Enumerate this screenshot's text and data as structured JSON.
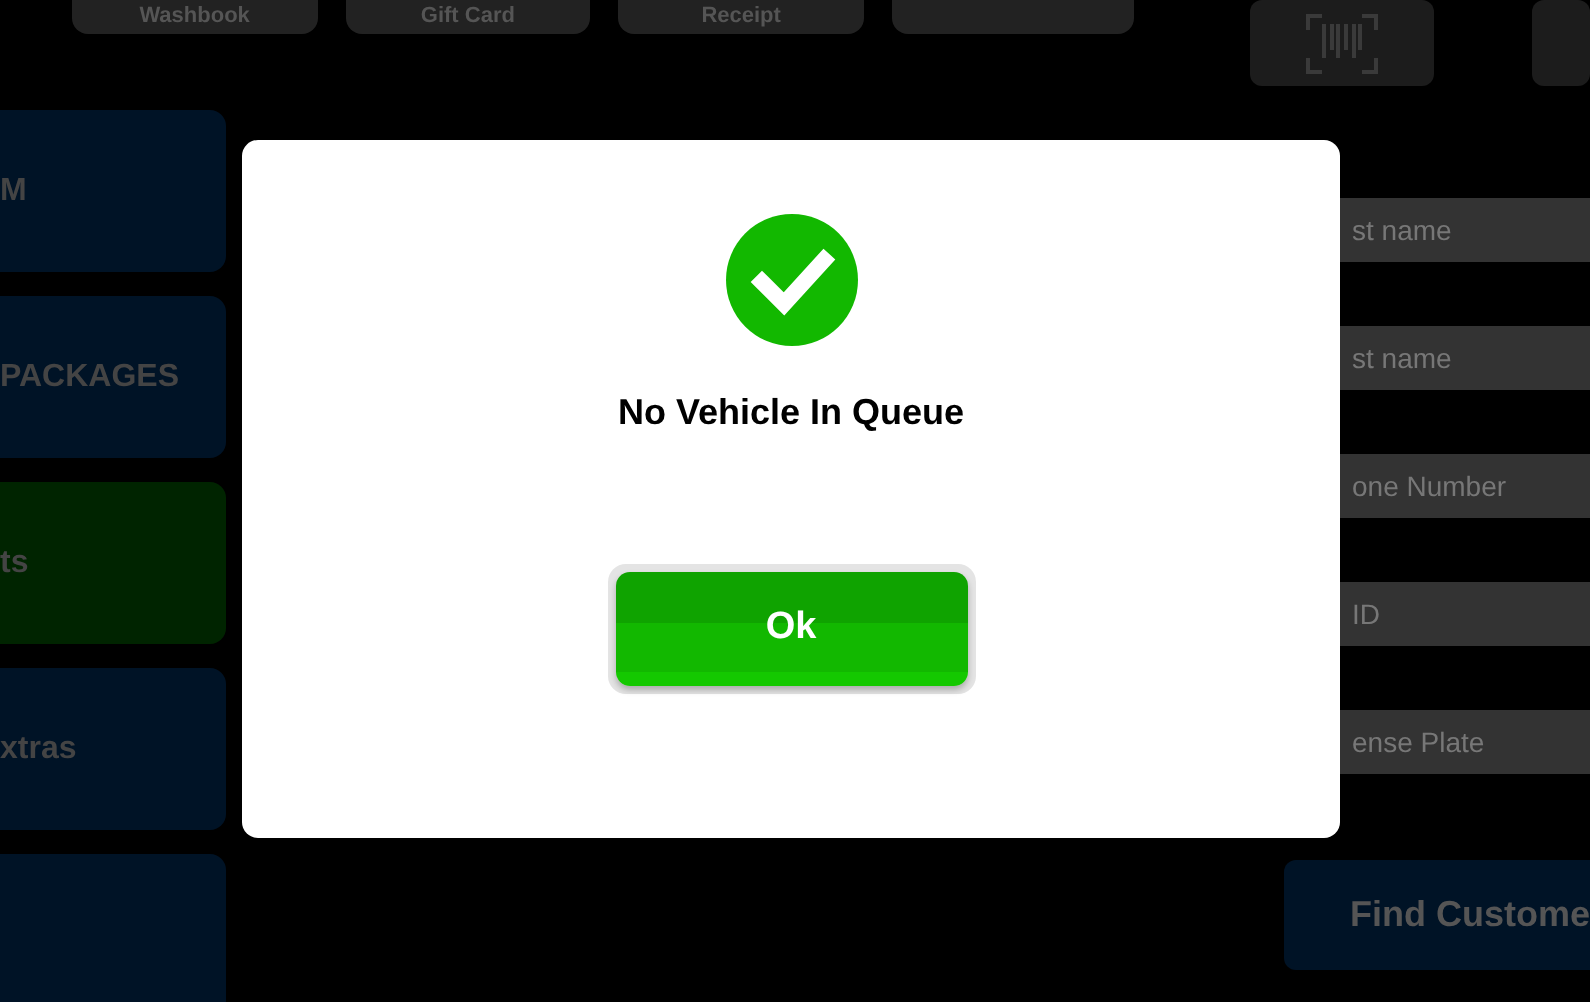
{
  "top_buttons": [
    {
      "label": "Washbook"
    },
    {
      "label": "Gift Card"
    },
    {
      "label": "Receipt"
    }
  ],
  "menu_tiles": [
    {
      "label": "M",
      "selected": false
    },
    {
      "label": "PACKAGES",
      "selected": false
    },
    {
      "label": "ts",
      "selected": true
    },
    {
      "label": "xtras",
      "selected": false
    },
    {
      "selected": false
    }
  ],
  "search_fields": [
    {
      "placeholder": "st name"
    },
    {
      "placeholder": "st name"
    },
    {
      "placeholder": "one Number"
    },
    {
      "placeholder": "ID"
    },
    {
      "placeholder": "ense Plate"
    }
  ],
  "find_button": "Find Custome",
  "dialog": {
    "message": "No Vehicle In Queue",
    "button": "Ok"
  }
}
